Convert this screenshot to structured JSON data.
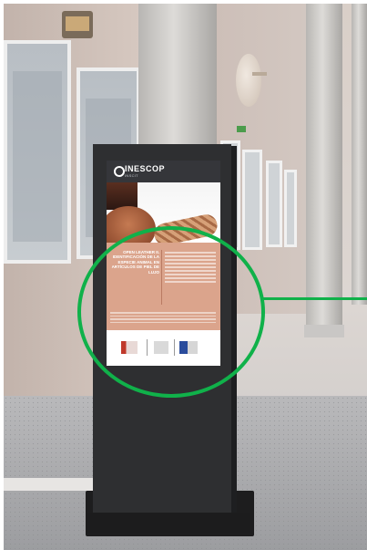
{
  "poster": {
    "brand": "INESCOP",
    "brand_sub": "INSCIT",
    "title": "OPEN LEATHER II. IDENTIFICACIÓN DE LA ESPECIE ANIMAL EN ARTÍCULOS DE PIEL DE LUJO"
  },
  "colors": {
    "highlight": "#10b14a",
    "poster_panel": "#dba48c",
    "kiosk": "#2e2f31"
  },
  "icons": {
    "logo": "inescop-logo",
    "funder_logos": [
      "generalitat-logo",
      "ivace-logo",
      "eu-flag-logo"
    ]
  }
}
